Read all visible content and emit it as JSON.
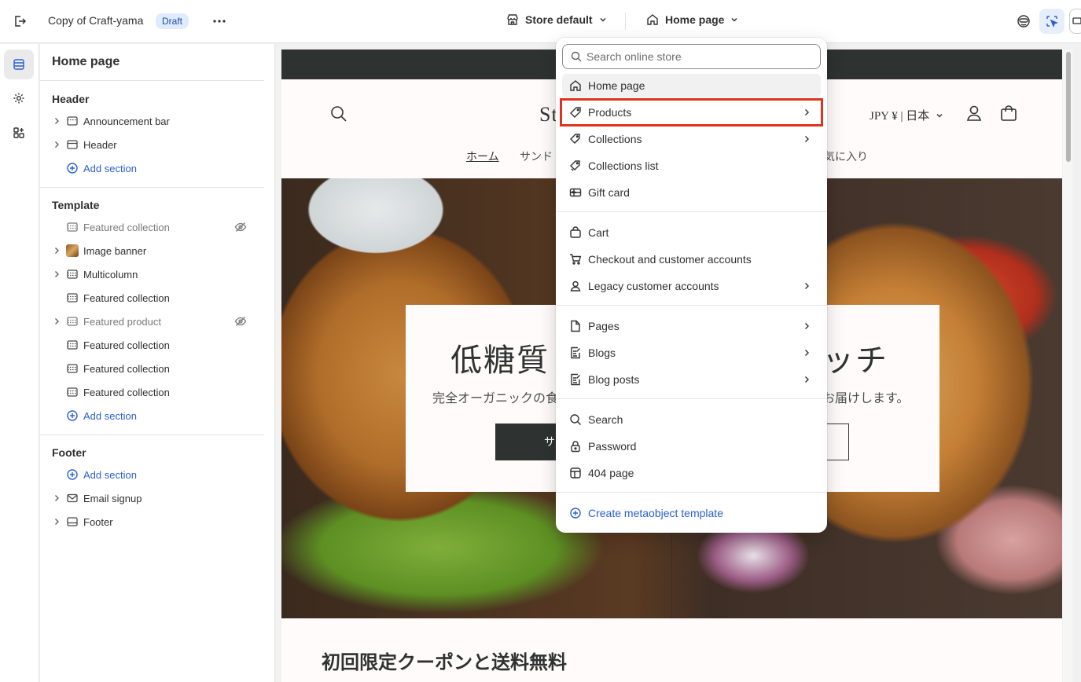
{
  "topbar": {
    "store_title": "Copy of Craft-yama",
    "status_badge": "Draft",
    "theme_select": "Store default",
    "page_select": "Home page"
  },
  "sidebar": {
    "title": "Home page",
    "groups": [
      {
        "label": "Header",
        "items": [
          {
            "label": "Announcement bar",
            "icon": "section-icon"
          },
          {
            "label": "Header",
            "icon": "section-icon"
          }
        ],
        "add_section": "Add section"
      },
      {
        "label": "Template",
        "items": [
          {
            "label": "Featured collection",
            "icon": "section-icon",
            "hidden": true
          },
          {
            "label": "Image banner",
            "icon": "image-thumbnail"
          },
          {
            "label": "Multicolumn",
            "icon": "section-icon"
          },
          {
            "label": "Featured collection",
            "icon": "section-icon"
          },
          {
            "label": "Featured product",
            "icon": "section-icon",
            "hidden": true
          },
          {
            "label": "Featured collection",
            "icon": "section-icon"
          },
          {
            "label": "Featured collection",
            "icon": "section-icon"
          },
          {
            "label": "Featured collection",
            "icon": "section-icon"
          }
        ],
        "add_section": "Add section"
      },
      {
        "label": "Footer",
        "add_section": "Add section",
        "items": [
          {
            "label": "Email signup",
            "icon": "email-icon"
          },
          {
            "label": "Footer",
            "icon": "section-icon"
          }
        ]
      }
    ]
  },
  "dropdown": {
    "search_placeholder": "Search online store",
    "items": [
      {
        "label": "Home page",
        "icon": "home-icon",
        "selected": true
      },
      {
        "label": "Products",
        "icon": "tag-icon",
        "submenu": true,
        "highlighted": true
      },
      {
        "label": "Collections",
        "icon": "collection-tag-icon",
        "submenu": true
      },
      {
        "label": "Collections list",
        "icon": "collection-list-icon"
      },
      {
        "label": "Gift card",
        "icon": "gift-card-icon"
      },
      {
        "label": "Cart",
        "icon": "bag-icon"
      },
      {
        "label": "Checkout and customer accounts",
        "icon": "cart-icon"
      },
      {
        "label": "Legacy customer accounts",
        "icon": "person-icon",
        "submenu": true
      },
      {
        "label": "Pages",
        "icon": "page-icon",
        "submenu": true
      },
      {
        "label": "Blogs",
        "icon": "blog-icon",
        "submenu": true
      },
      {
        "label": "Blog posts",
        "icon": "blog-post-icon",
        "submenu": true
      },
      {
        "label": "Search",
        "icon": "search-icon"
      },
      {
        "label": "Password",
        "icon": "lock-icon"
      },
      {
        "label": "404 page",
        "icon": "not-found-icon"
      }
    ],
    "create_link": "Create metaobject template"
  },
  "preview": {
    "logo_partial": "St",
    "currency": "JPY ¥ | 日本",
    "nav": [
      "ホーム",
      "サンド",
      "お気に入り"
    ],
    "hero_title_left": "低糖質",
    "hero_title_right": "ッチ",
    "hero_sub_left": "完全オーガニックの食",
    "hero_sub_right": "お届けします。",
    "hero_btn_partial": "サ",
    "coupon_heading": "初回限定クーポンと送料無料"
  },
  "colors": {
    "accent_blue": "#2a5fd1",
    "highlight_red": "#e0321c",
    "badge_bg": "#e0ebff",
    "store_dark": "#2e3331"
  }
}
